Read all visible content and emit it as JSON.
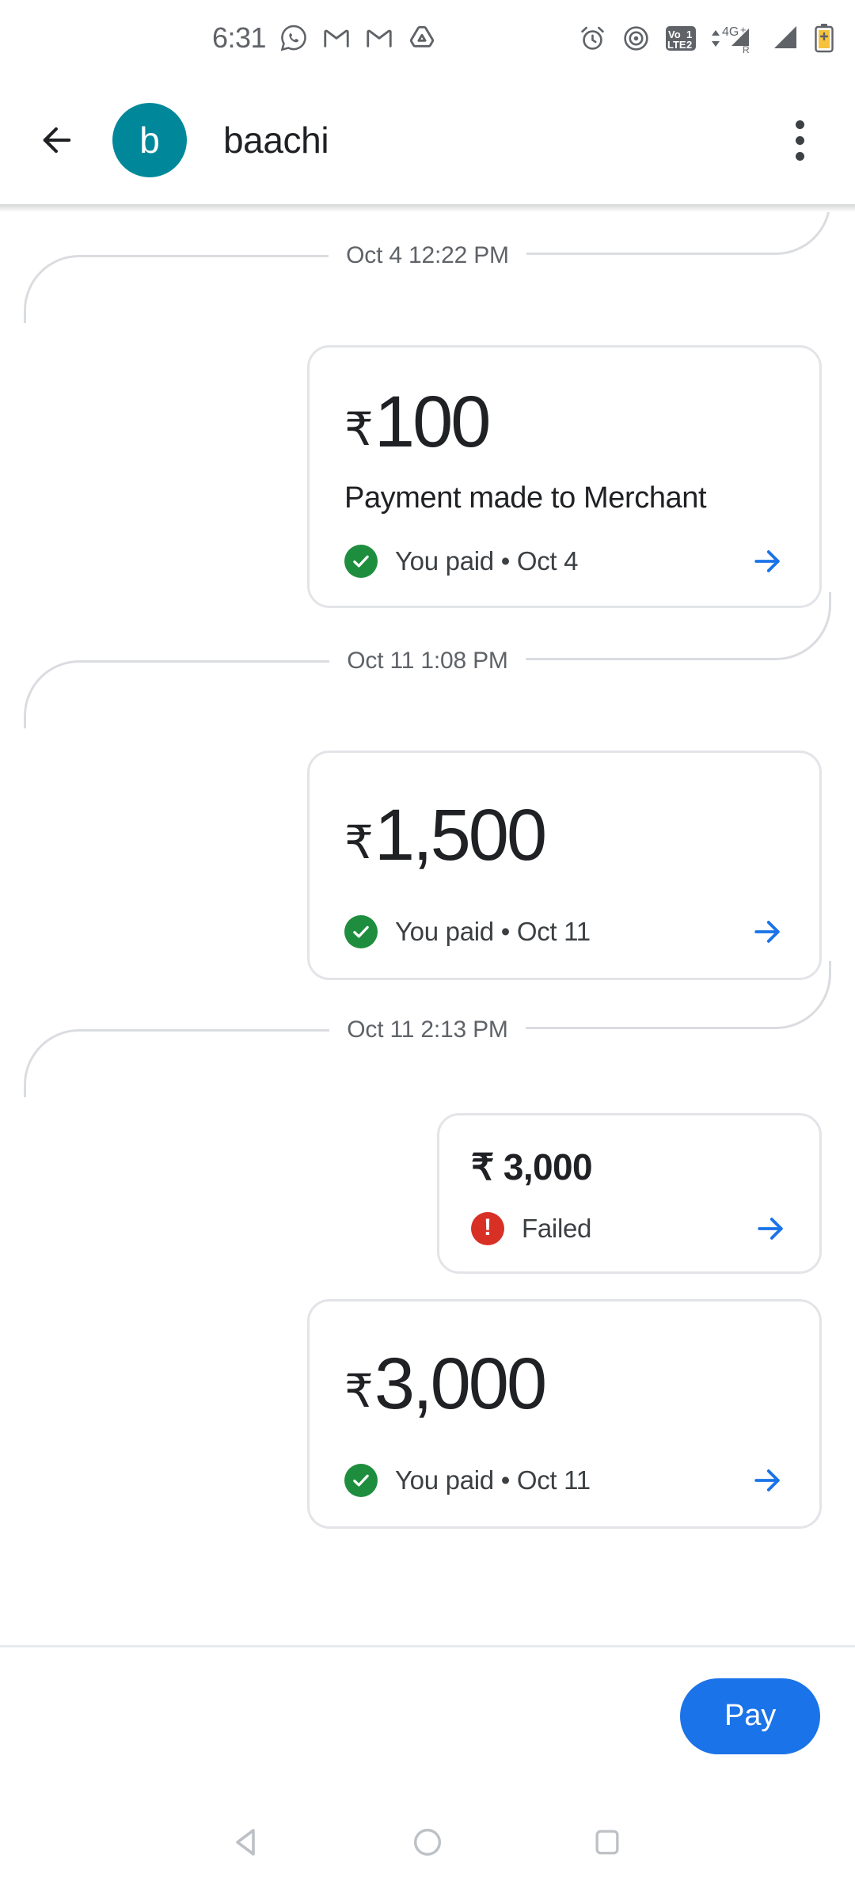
{
  "status_bar": {
    "time": "6:31",
    "left_icons": [
      "whatsapp-icon",
      "gmail-icon",
      "gmail-icon",
      "drive-icon"
    ],
    "right_icons": [
      "alarm-icon",
      "hotspot-icon",
      "volte-sim-icon",
      "mobile-data-4g-plus-icon",
      "signal-bars-icon",
      "battery-charging-icon"
    ],
    "network_label": "4G+",
    "volte_label_top": "VoLTE 1",
    "volte_label_bottom": "LTE 2",
    "roaming_label": "R",
    "icon_color": "#5f6368"
  },
  "app_bar": {
    "back_icon": "arrow-back-icon",
    "avatar_initial": "b",
    "avatar_color": "#00889a",
    "title": "baachi",
    "overflow_icon": "more-vertical-icon"
  },
  "conversation": {
    "transactions": [
      {
        "separator": "Oct 4 12:22 PM",
        "size": "large",
        "currency": "₹",
        "amount": "100",
        "note": "Payment made to Merchant",
        "status": "success",
        "status_icon": "check-circle-icon",
        "status_text": "You paid • Oct 4",
        "status_color": "#1e8e3e",
        "arrow_icon": "arrow-forward-icon"
      },
      {
        "separator": "Oct 11 1:08 PM",
        "size": "large",
        "currency": "₹",
        "amount": "1,500",
        "note": "",
        "status": "success",
        "status_icon": "check-circle-icon",
        "status_text": "You paid • Oct 11",
        "status_color": "#1e8e3e",
        "arrow_icon": "arrow-forward-icon"
      },
      {
        "separator": "Oct 11 2:13 PM",
        "size": "small",
        "currency": "₹",
        "amount": "3,000",
        "note": "",
        "status": "failed",
        "status_icon": "error-circle-icon",
        "status_text": "Failed",
        "status_color": "#d93025",
        "arrow_icon": "arrow-forward-icon"
      },
      {
        "separator": "",
        "size": "large",
        "currency": "₹",
        "amount": "3,000",
        "note": "",
        "status": "success",
        "status_icon": "check-circle-icon",
        "status_text": "You paid • Oct 11",
        "status_color": "#1e8e3e",
        "arrow_icon": "arrow-forward-icon"
      }
    ]
  },
  "bottom_bar": {
    "pay_label": "Pay",
    "pay_color": "#1a73e8"
  },
  "nav_bar": {
    "back_icon": "nav-back-triangle-icon",
    "home_icon": "nav-home-circle-icon",
    "recents_icon": "nav-recents-square-icon",
    "icon_color": "#bdc1c6"
  }
}
